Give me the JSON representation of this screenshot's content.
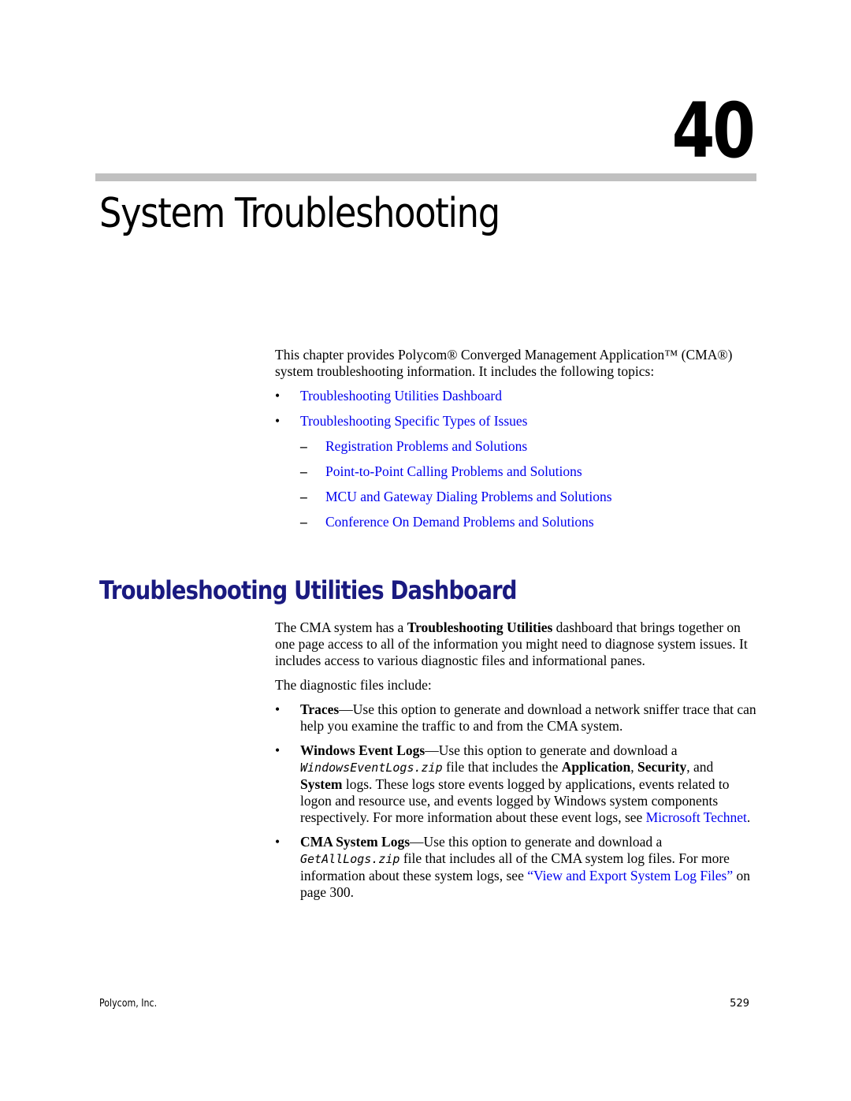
{
  "chapter": {
    "number": "40",
    "title": "System Troubleshooting"
  },
  "intro": {
    "text_part1": "This chapter provides Polycom® Converged Management Application™ (CMA®) system troubleshooting information. It includes the following topics:",
    "topics": [
      {
        "label": "Troubleshooting Utilities Dashboard",
        "level": 1
      },
      {
        "label": "Troubleshooting Specific Types of Issues",
        "level": 1
      },
      {
        "label": "Registration Problems and Solutions",
        "level": 2
      },
      {
        "label": "Point-to-Point Calling Problems and Solutions",
        "level": 2
      },
      {
        "label": "MCU and Gateway Dialing Problems and Solutions",
        "level": 2
      },
      {
        "label": "Conference On Demand Problems and Solutions",
        "level": 2
      }
    ],
    "bullet": "•",
    "dash": "–"
  },
  "section": {
    "heading": "Troubleshooting Utilities Dashboard",
    "p1_before": "The CMA system has a ",
    "p1_bold": "Troubleshooting Utilities",
    "p1_after": " dashboard that brings together on one page access to all of the information you might need to diagnose system issues. It includes access to various diagnostic files and informational panes.",
    "p2": "The diagnostic files include:",
    "files": {
      "traces": {
        "term": "Traces",
        "text": "—Use this option to generate and download a network sniffer trace that can help you examine the traffic to and from the CMA system."
      },
      "windows": {
        "term": "Windows Event Logs",
        "text1": "—Use this option to generate and download a ",
        "file": "WindowsEventLogs.zip",
        "text2": " file that includes the ",
        "b1": "Application",
        "sep1": ", ",
        "b2": "Security",
        "sep2": ", and ",
        "b3": "System",
        "text3": " logs. These logs store events logged by applications, events related to logon and resource use, and events logged by Windows system components respectively. For more information about these event logs, see ",
        "link": "Microsoft Technet",
        "end": "."
      },
      "cma": {
        "term": "CMA System Logs",
        "text1": "—Use this option to generate and download a ",
        "file": "GetAllLogs.zip",
        "text2": " file that includes all of the CMA system log files. For more information about these system logs, see ",
        "link": "“View and Export System Log Files”",
        "text3": " on page 300."
      }
    }
  },
  "footer": {
    "company": "Polycom, Inc.",
    "page": "529"
  },
  "colors": {
    "link": "#0000ee",
    "heading": "#1a1a80",
    "rule": "#c0c0c0"
  }
}
